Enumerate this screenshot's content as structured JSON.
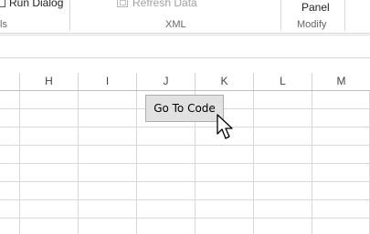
{
  "ribbon": {
    "run_dialog": "Run Dialog",
    "refresh_data": "Refresh Data",
    "panel": "Panel",
    "groups": {
      "left_partial": "ls",
      "xml": "XML",
      "modify": "Modify"
    }
  },
  "sheet": {
    "columns": [
      "H",
      "I",
      "J",
      "K",
      "L",
      "M"
    ]
  },
  "button": {
    "label": "Go To Code"
  },
  "icons": {
    "refresh": "refresh-data-icon",
    "cursor": "mouse-pointer-icon"
  }
}
